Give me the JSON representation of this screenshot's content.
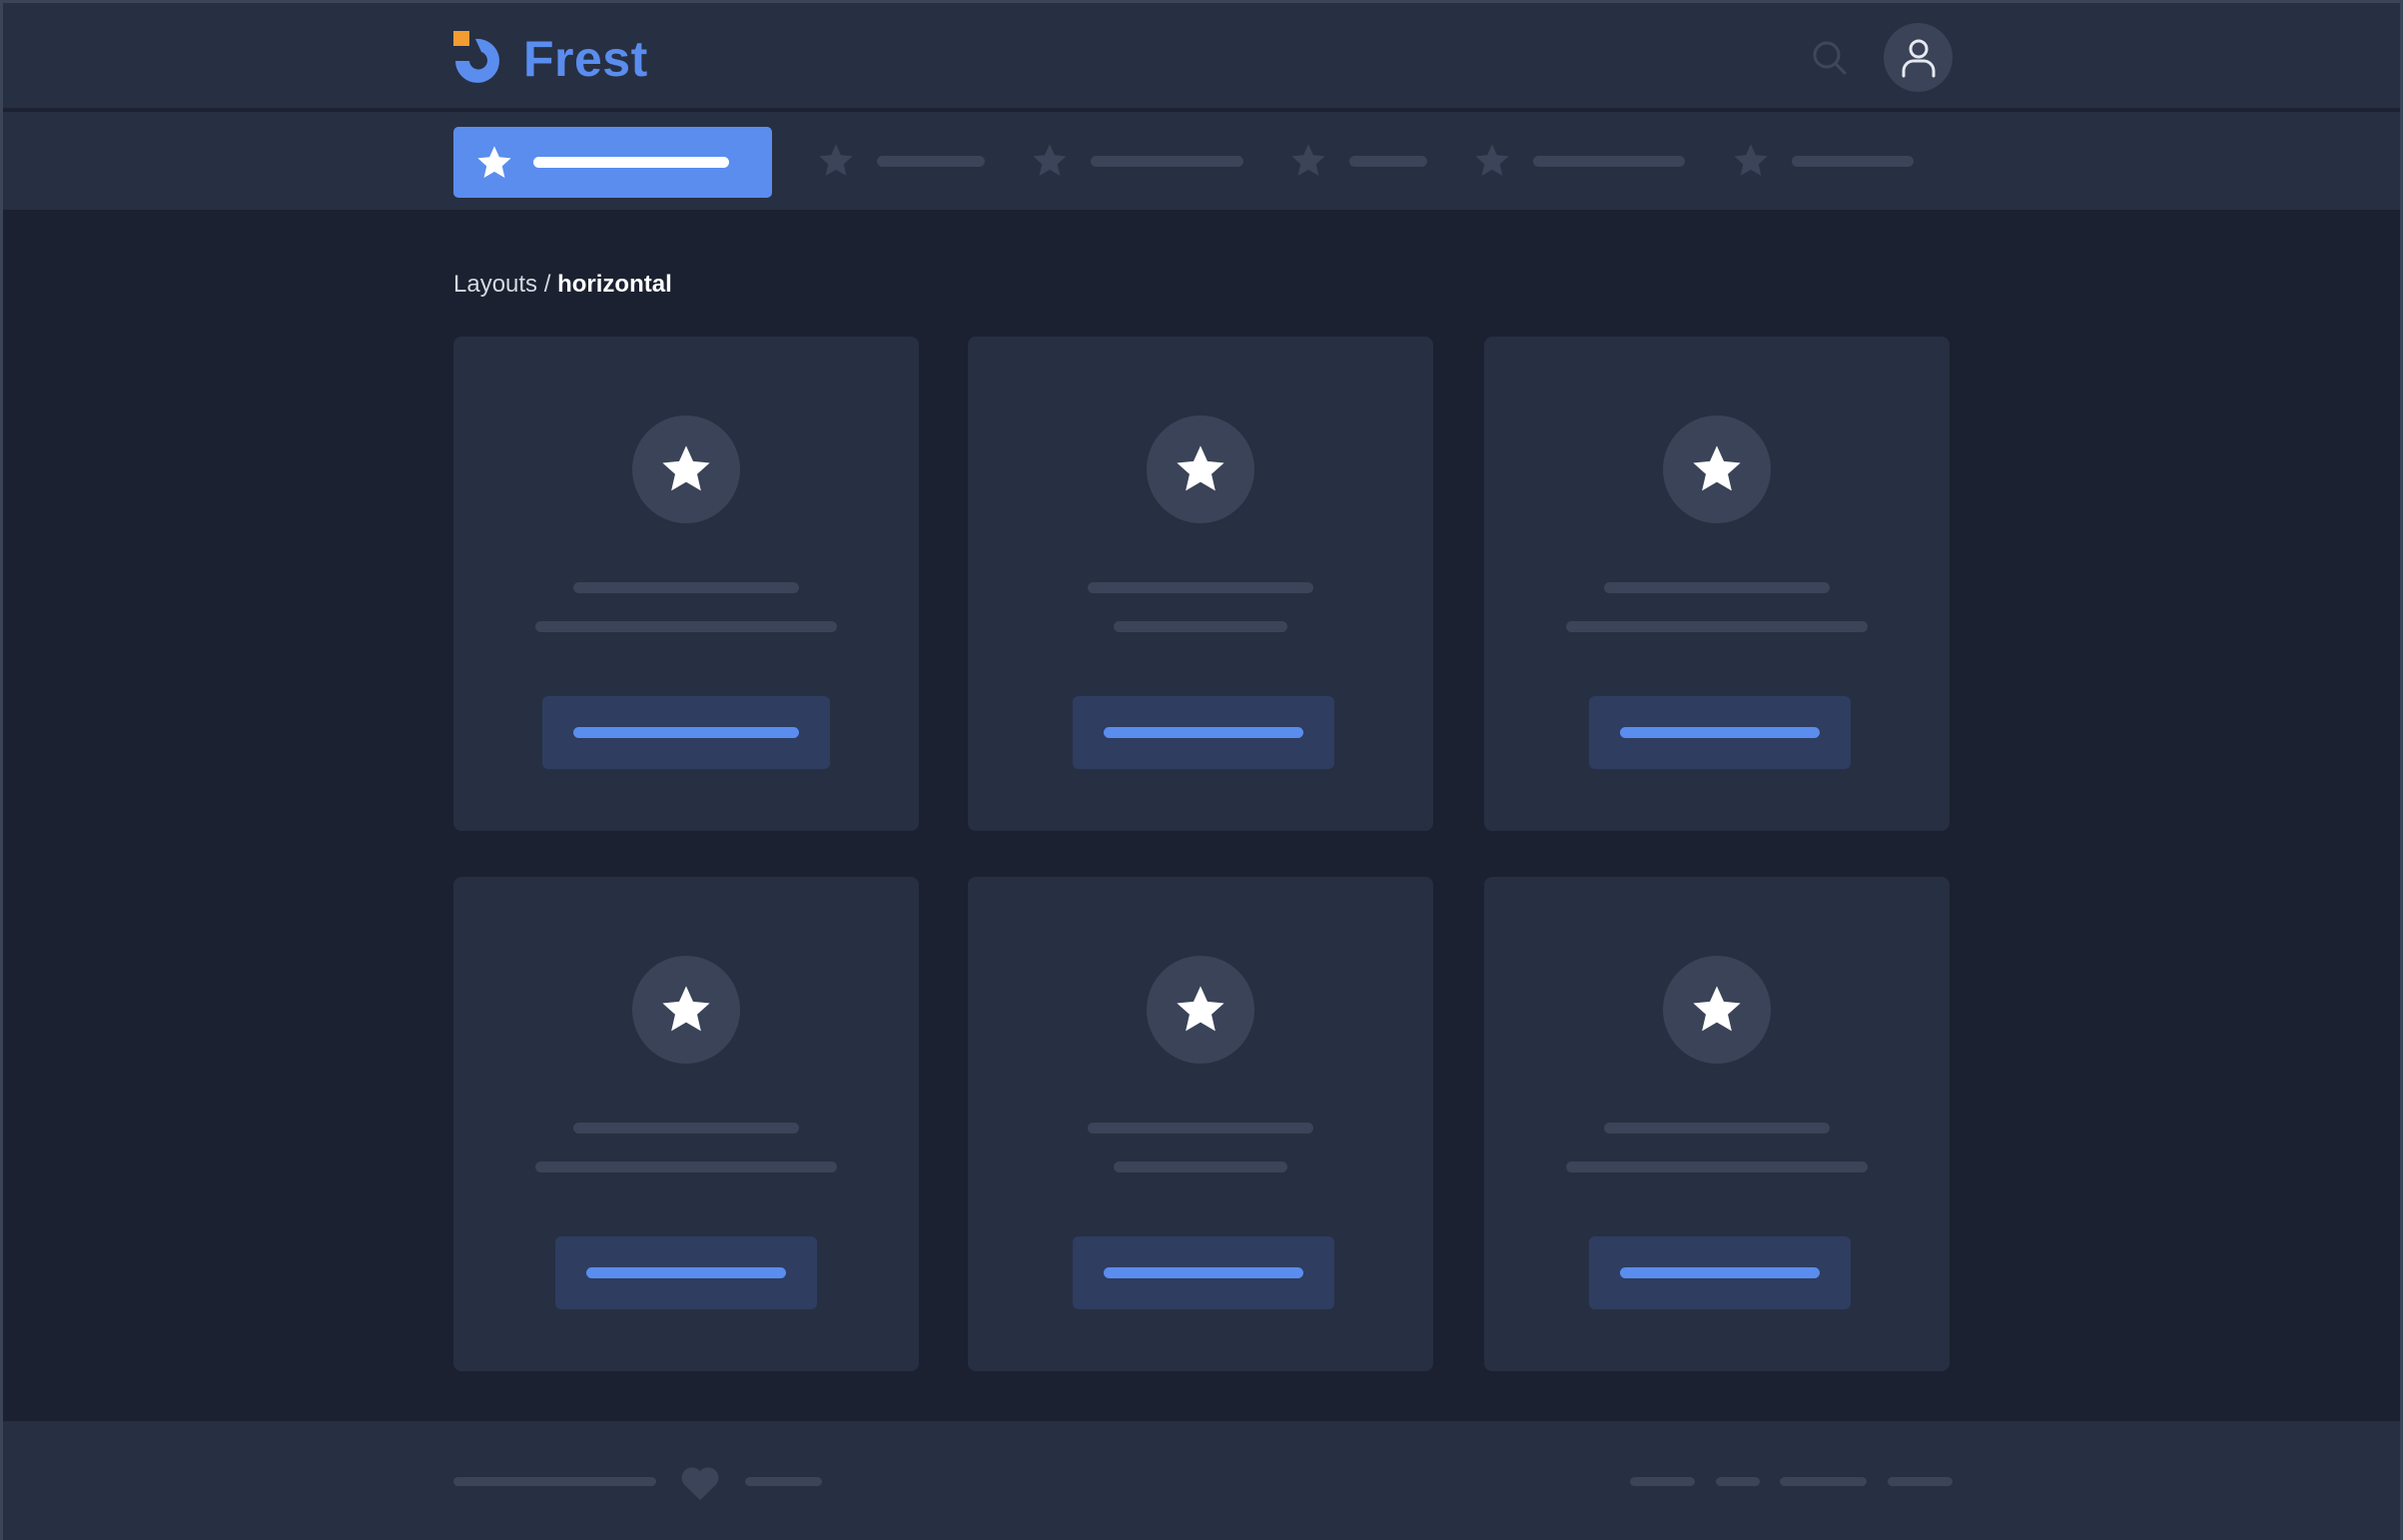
{
  "brand": {
    "name": "Frest"
  },
  "breadcrumb": {
    "parent": "Layouts",
    "separator": " / ",
    "current": "horizontal"
  },
  "icons": {
    "logo": "frest-logo-icon",
    "search": "search-icon",
    "avatar": "user-icon",
    "nav": "star-icon",
    "card": "star-icon",
    "footer": "heart-icon"
  },
  "colors": {
    "accent": "#5a8dee",
    "logo_orange": "#f39c32",
    "surface": "#272f42",
    "background": "#1b2130",
    "placeholder": "#3b4458"
  }
}
